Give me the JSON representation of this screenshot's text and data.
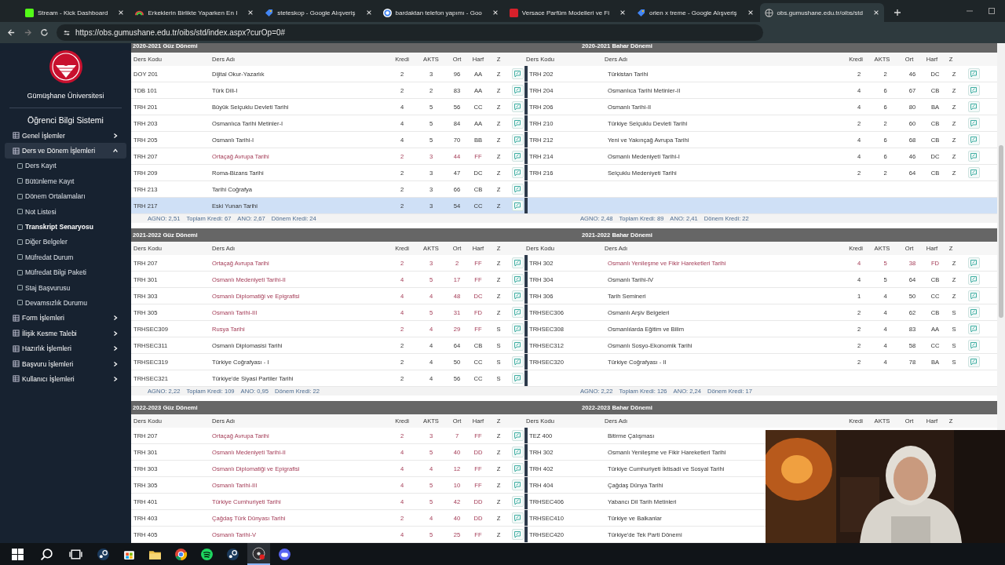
{
  "browser": {
    "tabs": [
      {
        "kind": "kick",
        "title": "Stream - Kick Dashboard",
        "selected": false
      },
      {
        "kind": "rainbow",
        "title": "Erkeklerin Birlikte Yaparken En I",
        "selected": false
      },
      {
        "kind": "shopping",
        "title": "steteskop - Google Alışveriş",
        "selected": false
      },
      {
        "kind": "google",
        "title": "bardaktan telefon yapımı - Goo",
        "selected": false
      },
      {
        "kind": "brand",
        "title": "Versace Parfüm Modelleri ve Fi",
        "selected": false
      },
      {
        "kind": "shopping",
        "title": "orien x treme - Google Alışveriş",
        "selected": false
      },
      {
        "kind": "globe",
        "title": "obs.gumushane.edu.tr/oibs/std",
        "selected": true
      }
    ],
    "url": "https://obs.gumushane.edu.tr/oibs/std/index.aspx?curOp=0#"
  },
  "sidebar": {
    "university": "Gümüşhane Üniversitesi",
    "system": "Öğrenci Bilgi Sistemi",
    "items": [
      {
        "label": "Genel İşlemler",
        "expanded": false
      },
      {
        "label": "Ders ve Dönem İşlemleri",
        "expanded": true,
        "children": [
          {
            "label": "Ders Kayıt",
            "selected": false
          },
          {
            "label": "Bütünleme Kayıt",
            "selected": false
          },
          {
            "label": "Dönem Ortalamaları",
            "selected": false
          },
          {
            "label": "Not Listesi",
            "selected": false
          },
          {
            "label": "Transkript Senaryosu",
            "selected": true
          },
          {
            "label": "Diğer Belgeler",
            "selected": false
          },
          {
            "label": "Müfredat Durum",
            "selected": false
          },
          {
            "label": "Müfredat Bilgi Paketi",
            "selected": false
          },
          {
            "label": "Staj Başvurusu",
            "selected": false
          },
          {
            "label": "Devamsızlık Durumu",
            "selected": false
          }
        ]
      },
      {
        "label": "Form İşlemleri",
        "expanded": false
      },
      {
        "label": "İlişik Kesme Talebi",
        "expanded": false
      },
      {
        "label": "Hazırlık İşlemleri",
        "expanded": false
      },
      {
        "label": "Başvuru İşlemleri",
        "expanded": false
      },
      {
        "label": "Kullanıcı İşlemleri",
        "expanded": false
      }
    ]
  },
  "years": [
    {
      "fall": {
        "title": "2020-2021 Güz Dönemi",
        "columns": [
          "Ders Kodu",
          "Ders Adı",
          "Kredi",
          "AKTS",
          "Ort",
          "Harf",
          "Z"
        ],
        "summary": [
          "AGNO: 2,51",
          "Toplam Kredi: 67",
          "ANO: 2,67",
          "Dönem Kredi: 24"
        ]
      },
      "spring": {
        "title": "2020-2021 Bahar Dönemi",
        "columns": [
          "Ders Kodu",
          "Ders Adı",
          "Kredi",
          "AKTS",
          "Ort",
          "Harf",
          "Z"
        ],
        "summary": [
          "AGNO: 2,48",
          "Toplam Kredi: 89",
          "ANO: 2,41",
          "Dönem Kredi: 22"
        ]
      },
      "rows": [
        {
          "selected": false,
          "fall": {
            "code": "DOY 201",
            "name": "Dijital Okur-Yazarlık",
            "kredi": "2",
            "akts": "3",
            "ort": "96",
            "harf": "AA",
            "z": "Z",
            "failed": false
          },
          "spring": {
            "code": "TRH 202",
            "name": "Türkistan Tarihi",
            "kredi": "2",
            "akts": "2",
            "ort": "46",
            "harf": "DC",
            "z": "Z",
            "failed": false
          }
        },
        {
          "selected": false,
          "fall": {
            "code": "TDB 101",
            "name": "Türk Dili-I",
            "kredi": "2",
            "akts": "2",
            "ort": "83",
            "harf": "AA",
            "z": "Z",
            "failed": false
          },
          "spring": {
            "code": "TRH 204",
            "name": "Osmanlıca Tarihi Metinler-II",
            "kredi": "4",
            "akts": "6",
            "ort": "67",
            "harf": "CB",
            "z": "Z",
            "failed": false
          }
        },
        {
          "selected": false,
          "fall": {
            "code": "TRH 201",
            "name": "Büyük Selçuklu Devleti Tarihi",
            "kredi": "4",
            "akts": "5",
            "ort": "56",
            "harf": "CC",
            "z": "Z",
            "failed": false
          },
          "spring": {
            "code": "TRH 206",
            "name": "Osmanlı Tarihi-II",
            "kredi": "4",
            "akts": "6",
            "ort": "80",
            "harf": "BA",
            "z": "Z",
            "failed": false
          }
        },
        {
          "selected": false,
          "fall": {
            "code": "TRH 203",
            "name": "Osmanlıca Tarihi Metinler-I",
            "kredi": "4",
            "akts": "5",
            "ort": "84",
            "harf": "AA",
            "z": "Z",
            "failed": false
          },
          "spring": {
            "code": "TRH 210",
            "name": "Türkiye Selçuklu Devleti Tarihi",
            "kredi": "2",
            "akts": "2",
            "ort": "60",
            "harf": "CB",
            "z": "Z",
            "failed": false
          }
        },
        {
          "selected": false,
          "fall": {
            "code": "TRH 205",
            "name": "Osmanlı Tarihi-I",
            "kredi": "4",
            "akts": "5",
            "ort": "70",
            "harf": "BB",
            "z": "Z",
            "failed": false
          },
          "spring": {
            "code": "TRH 212",
            "name": "Yeni ve Yakınçağ Avrupa Tarihi",
            "kredi": "4",
            "akts": "6",
            "ort": "68",
            "harf": "CB",
            "z": "Z",
            "failed": false
          }
        },
        {
          "selected": false,
          "fall": {
            "code": "TRH 207",
            "name": "Ortaçağ Avrupa Tarihi",
            "kredi": "2",
            "akts": "3",
            "ort": "44",
            "harf": "FF",
            "z": "Z",
            "failed": true
          },
          "spring": {
            "code": "TRH 214",
            "name": "Osmanlı Medeniyeti Tarihi-I",
            "kredi": "4",
            "akts": "6",
            "ort": "46",
            "harf": "DC",
            "z": "Z",
            "failed": false
          }
        },
        {
          "selected": false,
          "fall": {
            "code": "TRH 209",
            "name": "Roma-Bizans Tarihi",
            "kredi": "2",
            "akts": "3",
            "ort": "47",
            "harf": "DC",
            "z": "Z",
            "failed": false
          },
          "spring": {
            "code": "TRH 216",
            "name": "Selçuklu Medeniyeti Tarihi",
            "kredi": "2",
            "akts": "2",
            "ort": "64",
            "harf": "CB",
            "z": "Z",
            "failed": false
          }
        },
        {
          "selected": false,
          "fall": {
            "code": "TRH 213",
            "name": "Tarihi Coğrafya",
            "kredi": "2",
            "akts": "3",
            "ort": "66",
            "harf": "CB",
            "z": "Z",
            "failed": false
          }
        },
        {
          "selected": true,
          "fall": {
            "code": "TRH 217",
            "name": "Eski Yunan Tarihi",
            "kredi": "2",
            "akts": "3",
            "ort": "54",
            "harf": "CC",
            "z": "Z",
            "failed": false
          }
        }
      ]
    },
    {
      "fall": {
        "title": "2021-2022 Güz Dönemi",
        "columns": [
          "Ders Kodu",
          "Ders Adı",
          "Kredi",
          "AKTS",
          "Ort",
          "Harf",
          "Z"
        ],
        "summary": [
          "AGNO: 2,22",
          "Toplam Kredi: 109",
          "ANO: 0,95",
          "Dönem Kredi: 22"
        ]
      },
      "spring": {
        "title": "2021-2022 Bahar Dönemi",
        "columns": [
          "Ders Kodu",
          "Ders Adı",
          "Kredi",
          "AKTS",
          "Ort",
          "Harf",
          "Z"
        ],
        "summary": [
          "AGNO: 2,22",
          "Toplam Kredi: 126",
          "ANO: 2,24",
          "Dönem Kredi: 17"
        ]
      },
      "rows": [
        {
          "selected": false,
          "fall": {
            "code": "TRH 207",
            "name": "Ortaçağ Avrupa Tarihi",
            "kredi": "2",
            "akts": "3",
            "ort": "2",
            "harf": "FF",
            "z": "Z",
            "failed": true
          },
          "spring": {
            "code": "TRH 302",
            "name": "Osmanlı Yenileşme ve Fikir Hareketleri Tarihi",
            "kredi": "4",
            "akts": "5",
            "ort": "38",
            "harf": "FD",
            "z": "Z",
            "failed": true
          }
        },
        {
          "selected": false,
          "fall": {
            "code": "TRH 301",
            "name": "Osmanlı Medeniyeti Tarihi-II",
            "kredi": "4",
            "akts": "5",
            "ort": "17",
            "harf": "FF",
            "z": "Z",
            "failed": true
          },
          "spring": {
            "code": "TRH 304",
            "name": "Osmanlı Tarihi-IV",
            "kredi": "4",
            "akts": "5",
            "ort": "64",
            "harf": "CB",
            "z": "Z",
            "failed": false
          }
        },
        {
          "selected": false,
          "fall": {
            "code": "TRH 303",
            "name": "Osmanlı Diplomatiği ve Epigrafisi",
            "kredi": "4",
            "akts": "4",
            "ort": "48",
            "harf": "DC",
            "z": "Z",
            "failed": true
          },
          "spring": {
            "code": "TRH 306",
            "name": "Tarih Semineri",
            "kredi": "1",
            "akts": "4",
            "ort": "50",
            "harf": "CC",
            "z": "Z",
            "failed": false
          }
        },
        {
          "selected": false,
          "fall": {
            "code": "TRH 305",
            "name": "Osmanlı Tarihi-III",
            "kredi": "4",
            "akts": "5",
            "ort": "31",
            "harf": "FD",
            "z": "Z",
            "failed": true
          },
          "spring": {
            "code": "TRHSEC306",
            "name": "Osmanlı Arşiv Belgeleri",
            "kredi": "2",
            "akts": "4",
            "ort": "62",
            "harf": "CB",
            "z": "S",
            "failed": false
          }
        },
        {
          "selected": false,
          "fall": {
            "code": "TRHSEC309",
            "name": "Rusya Tarihi",
            "kredi": "2",
            "akts": "4",
            "ort": "29",
            "harf": "FF",
            "z": "S",
            "failed": true
          },
          "spring": {
            "code": "TRHSEC308",
            "name": "Osmanlılarda Eğitim ve Bilim",
            "kredi": "2",
            "akts": "4",
            "ort": "83",
            "harf": "AA",
            "z": "S",
            "failed": false
          }
        },
        {
          "selected": false,
          "fall": {
            "code": "TRHSEC311",
            "name": "Osmanlı Diplomasisi Tarihi",
            "kredi": "2",
            "akts": "4",
            "ort": "64",
            "harf": "CB",
            "z": "S",
            "failed": false
          },
          "spring": {
            "code": "TRHSEC312",
            "name": "Osmanlı Sosyo-Ekonomik Tarihi",
            "kredi": "2",
            "akts": "4",
            "ort": "58",
            "harf": "CC",
            "z": "S",
            "failed": false
          }
        },
        {
          "selected": false,
          "fall": {
            "code": "TRHSEC319",
            "name": "Türkiye Coğrafyası - I",
            "kredi": "2",
            "akts": "4",
            "ort": "50",
            "harf": "CC",
            "z": "S",
            "failed": false
          },
          "spring": {
            "code": "TRHSEC320",
            "name": "Türkiye Coğrafyası - II",
            "kredi": "2",
            "akts": "4",
            "ort": "78",
            "harf": "BA",
            "z": "S",
            "failed": false
          }
        },
        {
          "selected": false,
          "fall": {
            "code": "TRHSEC321",
            "name": "Türkiye'de Siyasi Partiler Tarihi",
            "kredi": "2",
            "akts": "4",
            "ort": "56",
            "harf": "CC",
            "z": "S",
            "failed": false
          }
        }
      ]
    },
    {
      "fall": {
        "title": "2022-2023 Güz Dönemi",
        "columns": [
          "Ders Kodu",
          "Ders Adı",
          "Kredi",
          "AKTS",
          "Ort",
          "Harf",
          "Z"
        ]
      },
      "spring": {
        "title": "2022-2023 Bahar Dönemi",
        "columns": [
          "Ders Kodu",
          "Ders Adı",
          "Kredi",
          "AKTS",
          "Ort",
          "Harf",
          "Z"
        ]
      },
      "rows": [
        {
          "selected": false,
          "fall": {
            "code": "TRH 207",
            "name": "Ortaçağ Avrupa Tarihi",
            "kredi": "2",
            "akts": "3",
            "ort": "7",
            "harf": "FF",
            "z": "Z",
            "failed": true
          },
          "spring": {
            "code": "TEZ 400",
            "name": "Bitirme Çalışması",
            "failed": false
          }
        },
        {
          "selected": false,
          "fall": {
            "code": "TRH 301",
            "name": "Osmanlı Medeniyeti Tarihi-II",
            "kredi": "4",
            "akts": "5",
            "ort": "40",
            "harf": "DD",
            "z": "Z",
            "failed": true
          },
          "spring": {
            "code": "TRH 302",
            "name": "Osmanlı Yenileşme ve Fikir Hareketleri Tarihi",
            "failed": false
          }
        },
        {
          "selected": false,
          "fall": {
            "code": "TRH 303",
            "name": "Osmanlı Diplomatiği ve Epigrafisi",
            "kredi": "4",
            "akts": "4",
            "ort": "12",
            "harf": "FF",
            "z": "Z",
            "failed": true
          },
          "spring": {
            "code": "TRH 402",
            "name": "Türkiye Cumhuriyeti İktisadi ve Sosyal Tarihi",
            "failed": false
          }
        },
        {
          "selected": false,
          "fall": {
            "code": "TRH 305",
            "name": "Osmanlı Tarihi-III",
            "kredi": "4",
            "akts": "5",
            "ort": "10",
            "harf": "FF",
            "z": "Z",
            "failed": true
          },
          "spring": {
            "code": "TRH 404",
            "name": "Çağdaş Dünya Tarihi",
            "failed": false
          }
        },
        {
          "selected": false,
          "fall": {
            "code": "TRH 401",
            "name": "Türkiye Cumhuriyeti Tarihi",
            "kredi": "4",
            "akts": "5",
            "ort": "42",
            "harf": "DD",
            "z": "Z",
            "failed": true
          },
          "spring": {
            "code": "TRHSEC406",
            "name": "Yabancı Dil Tarih Metinleri",
            "failed": false
          }
        },
        {
          "selected": false,
          "fall": {
            "code": "TRH 403",
            "name": "Çağdaş Türk Dünyası Tarihi",
            "kredi": "2",
            "akts": "4",
            "ort": "40",
            "harf": "DD",
            "z": "Z",
            "failed": true
          },
          "spring": {
            "code": "TRHSEC410",
            "name": "Türkiye ve Balkanlar",
            "failed": false
          }
        },
        {
          "selected": false,
          "fall": {
            "code": "TRH 405",
            "name": "Osmanlı Tarihi-V",
            "kredi": "4",
            "akts": "5",
            "ort": "25",
            "harf": "FF",
            "z": "Z",
            "failed": true
          },
          "spring": {
            "code": "TRHSEC420",
            "name": "Türkiye'de Tek Parti Dönemi",
            "failed": false
          }
        }
      ]
    }
  ],
  "taskbar": {
    "apps": [
      {
        "kind": "steam",
        "selected": false
      },
      {
        "kind": "store",
        "selected": false
      },
      {
        "kind": "folder",
        "selected": false
      },
      {
        "kind": "chrome",
        "selected": false
      },
      {
        "kind": "music",
        "selected": false
      },
      {
        "kind": "steam",
        "selected": false
      },
      {
        "kind": "record",
        "selected": true
      },
      {
        "kind": "chat",
        "selected": false
      }
    ]
  }
}
